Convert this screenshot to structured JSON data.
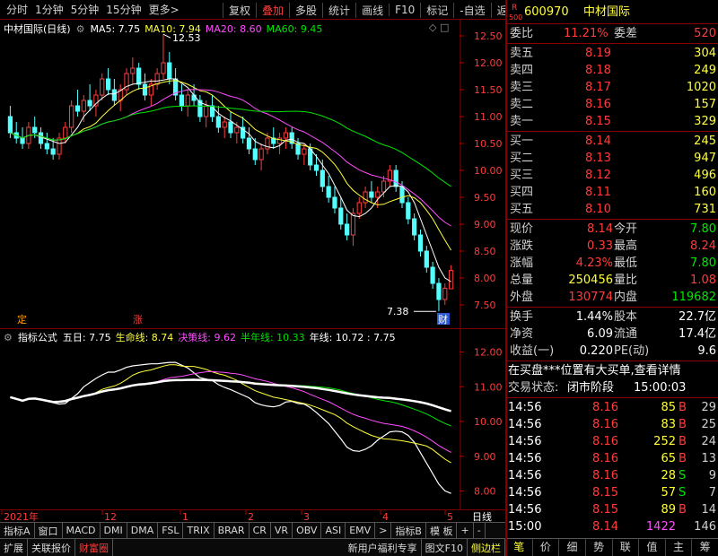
{
  "toolbar": {
    "left_tabs": [
      "分时",
      "1分钟",
      "5分钟",
      "15分钟",
      "更多>"
    ],
    "right_tabs": [
      "复权",
      "叠加",
      "多股",
      "统计",
      "画线",
      "F10",
      "标记",
      "-自选",
      "返回"
    ],
    "active_right": "叠加"
  },
  "main_chart": {
    "title": "中材国际(日线)",
    "ma_labels": [
      {
        "text": "MA5: 7.75",
        "color": "#ffffff"
      },
      {
        "text": "MA10: 7.94",
        "color": "#ffff3c"
      },
      {
        "text": "MA20: 8.60",
        "color": "#ff4dff"
      },
      {
        "text": "MA60: 9.45",
        "color": "#00e600"
      }
    ],
    "y_ticks": [
      "12.50",
      "12.00",
      "11.50",
      "11.00",
      "10.50",
      "10.00",
      "9.50",
      "9.00",
      "8.50",
      "8.00",
      "7.50"
    ],
    "high_label": "12.53",
    "low_label": "7.38",
    "badge_ding": "定",
    "badge_zhang": "涨",
    "badge_cai": "财"
  },
  "indicator": {
    "title": "指标公式",
    "items": [
      {
        "text": "五日: 7.75",
        "color": "#ffffff"
      },
      {
        "text": "生命线: 8.74",
        "color": "#ffff3c"
      },
      {
        "text": "决策线: 9.62",
        "color": "#ff4dff"
      },
      {
        "text": "半年线: 10.33",
        "color": "#00e600"
      },
      {
        "text": "年线: 10.72 : 7.75",
        "color": "#ffffff"
      }
    ],
    "y_ticks": [
      "12.00",
      "11.00",
      "10.00",
      "9.00",
      "8.00"
    ]
  },
  "xaxis": {
    "labels": [
      "2021年",
      "12",
      "1",
      "2",
      "3",
      "4",
      "5"
    ],
    "period": "日线"
  },
  "tabs_row1": [
    "指标A",
    "窗口",
    "MACD",
    "DMI",
    "DMA",
    "FSL",
    "TRIX",
    "BRAR",
    "CR",
    "VR",
    "OBV",
    "ASI",
    "EMV",
    ">",
    "指标B",
    "模 板",
    "+",
    "-"
  ],
  "tabs_row2": [
    "扩展",
    "关联报价",
    "财富圈"
  ],
  "tabs_row2_right": [
    "新用户福利专享",
    "图文F10",
    "侧边栏"
  ],
  "quote": {
    "code": "600970",
    "name": "中材国际",
    "r_mark": "R",
    "r_sub": "500",
    "weibi_label": "委比",
    "weibi": "11.21%",
    "weicha_label": "委差",
    "weicha": "520",
    "asks": [
      {
        "label": "卖五",
        "price": "8.19",
        "vol": "304"
      },
      {
        "label": "卖四",
        "price": "8.18",
        "vol": "249"
      },
      {
        "label": "卖三",
        "price": "8.17",
        "vol": "1020"
      },
      {
        "label": "卖二",
        "price": "8.16",
        "vol": "157"
      },
      {
        "label": "卖一",
        "price": "8.15",
        "vol": "329"
      }
    ],
    "bids": [
      {
        "label": "买一",
        "price": "8.14",
        "vol": "245"
      },
      {
        "label": "买二",
        "price": "8.13",
        "vol": "947"
      },
      {
        "label": "买三",
        "price": "8.12",
        "vol": "496"
      },
      {
        "label": "买四",
        "price": "8.11",
        "vol": "160"
      },
      {
        "label": "买五",
        "price": "8.10",
        "vol": "731"
      }
    ],
    "stats": [
      {
        "l1": "现价",
        "v1": "8.14",
        "c1": "#ff3c3c",
        "l2": "今开",
        "v2": "7.80",
        "c2": "#00e600"
      },
      {
        "l1": "涨跌",
        "v1": "0.33",
        "c1": "#ff3c3c",
        "l2": "最高",
        "v2": "8.24",
        "c2": "#ff3c3c"
      },
      {
        "l1": "涨幅",
        "v1": "4.23%",
        "c1": "#ff3c3c",
        "l2": "最低",
        "v2": "7.80",
        "c2": "#00e600"
      },
      {
        "l1": "总量",
        "v1": "250456",
        "c1": "#ffff3c",
        "l2": "量比",
        "v2": "1.08",
        "c2": "#ff3c3c"
      },
      {
        "l1": "外盘",
        "v1": "130774",
        "c1": "#ff3c3c",
        "l2": "内盘",
        "v2": "119682",
        "c2": "#00e600"
      }
    ],
    "stats2": [
      {
        "l1": "换手",
        "v1": "1.44%",
        "l2": "股本",
        "v2": "22.7亿"
      },
      {
        "l1": "净资",
        "v1": "6.09",
        "l2": "流通",
        "v2": "17.4亿"
      },
      {
        "l1": "收益(一)",
        "v1": "0.220",
        "l2": "PE(动)",
        "v2": "9.6"
      }
    ],
    "notice": "在买盘***位置有大买单,查看详情",
    "status_label": "交易状态:",
    "status_value": "闭市阶段",
    "status_time": "15:00:03",
    "ticks": [
      {
        "t": "14:56",
        "p": "8.16",
        "v": "85",
        "bs": "B",
        "n": "29"
      },
      {
        "t": "14:56",
        "p": "8.16",
        "v": "83",
        "bs": "B",
        "n": "25"
      },
      {
        "t": "14:56",
        "p": "8.16",
        "v": "252",
        "bs": "B",
        "n": "24"
      },
      {
        "t": "14:56",
        "p": "8.16",
        "v": "65",
        "bs": "B",
        "n": "13"
      },
      {
        "t": "14:56",
        "p": "8.16",
        "v": "28",
        "bs": "S",
        "n": "9"
      },
      {
        "t": "14:56",
        "p": "8.15",
        "v": "57",
        "bs": "S",
        "n": "7"
      },
      {
        "t": "14:56",
        "p": "8.15",
        "v": "89",
        "bs": "B",
        "n": "14"
      },
      {
        "t": "15:00",
        "p": "8.14",
        "v": "1422",
        "bs": "",
        "n": "146"
      }
    ],
    "bottom_tabs": [
      "笔",
      "价",
      "细",
      "势",
      "联",
      "值",
      "主",
      "筹"
    ]
  },
  "chart_data": {
    "type": "candlestick",
    "title": "中材国际(日线)",
    "ylim": [
      7.3,
      12.7
    ],
    "candles": [
      [
        11.0,
        11.2,
        10.6,
        10.7
      ],
      [
        10.7,
        10.9,
        10.5,
        10.6
      ],
      [
        10.6,
        10.8,
        10.4,
        10.5
      ],
      [
        10.5,
        10.9,
        10.4,
        10.8
      ],
      [
        10.8,
        11.0,
        10.6,
        10.7
      ],
      [
        10.7,
        10.8,
        10.4,
        10.5
      ],
      [
        10.5,
        10.7,
        10.3,
        10.4
      ],
      [
        10.4,
        10.6,
        10.2,
        10.3
      ],
      [
        10.3,
        10.7,
        10.2,
        10.6
      ],
      [
        10.6,
        10.9,
        10.5,
        10.8
      ],
      [
        10.8,
        11.3,
        10.7,
        11.2
      ],
      [
        11.2,
        11.5,
        11.0,
        11.1
      ],
      [
        11.1,
        11.4,
        10.9,
        11.3
      ],
      [
        11.3,
        11.6,
        11.1,
        11.2
      ],
      [
        11.2,
        11.5,
        11.0,
        11.4
      ],
      [
        11.4,
        11.8,
        11.3,
        11.7
      ],
      [
        11.7,
        11.9,
        11.4,
        11.5
      ],
      [
        11.5,
        11.7,
        11.2,
        11.3
      ],
      [
        11.3,
        11.6,
        11.1,
        11.5
      ],
      [
        11.5,
        11.9,
        11.4,
        11.8
      ],
      [
        11.8,
        12.1,
        11.6,
        11.9
      ],
      [
        11.9,
        12.0,
        11.5,
        11.6
      ],
      [
        11.6,
        11.8,
        11.3,
        11.4
      ],
      [
        11.4,
        11.7,
        11.2,
        11.6
      ],
      [
        11.6,
        11.9,
        11.5,
        11.8
      ],
      [
        11.8,
        12.53,
        11.7,
        12.0
      ],
      [
        12.0,
        12.2,
        11.6,
        11.7
      ],
      [
        11.7,
        11.9,
        11.3,
        11.4
      ],
      [
        11.4,
        11.6,
        11.1,
        11.2
      ],
      [
        11.2,
        11.5,
        11.0,
        11.4
      ],
      [
        11.4,
        11.6,
        11.2,
        11.3
      ],
      [
        11.3,
        11.4,
        10.9,
        11.0
      ],
      [
        11.0,
        11.3,
        10.8,
        11.2
      ],
      [
        11.2,
        11.4,
        10.9,
        11.0
      ],
      [
        11.0,
        11.2,
        10.7,
        10.8
      ],
      [
        10.8,
        11.0,
        10.6,
        10.9
      ],
      [
        10.9,
        11.1,
        10.6,
        10.7
      ],
      [
        10.7,
        10.9,
        10.5,
        10.8
      ],
      [
        10.8,
        11.0,
        10.5,
        10.6
      ],
      [
        10.6,
        10.8,
        10.3,
        10.4
      ],
      [
        10.4,
        10.6,
        10.1,
        10.2
      ],
      [
        10.2,
        10.5,
        10.0,
        10.4
      ],
      [
        10.4,
        10.7,
        10.3,
        10.6
      ],
      [
        10.6,
        10.8,
        10.4,
        10.5
      ],
      [
        10.5,
        10.7,
        10.3,
        10.6
      ],
      [
        10.6,
        10.8,
        10.4,
        10.7
      ],
      [
        10.7,
        10.8,
        10.4,
        10.5
      ],
      [
        10.5,
        10.6,
        10.2,
        10.3
      ],
      [
        10.3,
        10.5,
        10.1,
        10.4
      ],
      [
        10.4,
        10.5,
        10.0,
        10.1
      ],
      [
        10.1,
        10.3,
        9.9,
        10.0
      ],
      [
        10.0,
        10.2,
        9.6,
        9.7
      ],
      [
        9.7,
        9.9,
        9.4,
        9.5
      ],
      [
        9.5,
        9.7,
        9.2,
        9.3
      ],
      [
        9.3,
        9.5,
        8.9,
        9.0
      ],
      [
        9.0,
        9.2,
        8.7,
        8.8
      ],
      [
        8.8,
        9.3,
        8.6,
        9.2
      ],
      [
        9.2,
        9.5,
        9.1,
        9.4
      ],
      [
        9.4,
        9.7,
        9.3,
        9.6
      ],
      [
        9.6,
        9.8,
        9.4,
        9.5
      ],
      [
        9.5,
        9.7,
        9.3,
        9.6
      ],
      [
        9.6,
        9.9,
        9.5,
        9.8
      ],
      [
        9.8,
        10.1,
        9.7,
        10.0
      ],
      [
        10.0,
        10.1,
        9.6,
        9.7
      ],
      [
        9.7,
        9.8,
        9.3,
        9.4
      ],
      [
        9.4,
        9.5,
        9.0,
        9.1
      ],
      [
        9.1,
        9.2,
        8.7,
        8.8
      ],
      [
        8.8,
        8.9,
        8.4,
        8.5
      ],
      [
        8.5,
        8.6,
        8.1,
        8.2
      ],
      [
        8.2,
        8.3,
        7.8,
        7.9
      ],
      [
        7.9,
        8.0,
        7.38,
        7.6
      ],
      [
        7.6,
        7.9,
        7.5,
        7.81
      ],
      [
        7.8,
        8.24,
        7.8,
        8.14
      ]
    ]
  }
}
